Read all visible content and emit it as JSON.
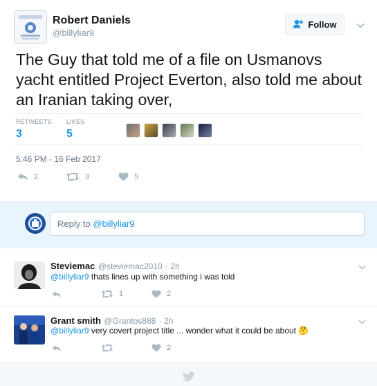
{
  "tweet": {
    "author_name": "Robert Daniels",
    "author_handle": "@billyliar9",
    "follow_label": "Follow",
    "text": "The Guy that told me of a file on Usmanovs yacht entitled Project Everton, also told me about an Iranian taking over,",
    "retweets_label": "RETWEETS",
    "retweets_count": "3",
    "likes_label": "LIKES",
    "likes_count": "5",
    "timestamp": "5:46 PM - 16 Feb 2017",
    "actions": {
      "reply_count": "2",
      "retweet_count": "3",
      "like_count": "5"
    }
  },
  "reply_box": {
    "prefix": "Reply to ",
    "mention": "@billyliar9"
  },
  "replies": [
    {
      "name": "Steviemac",
      "handle": "@steviemac2010",
      "time": "· 2h",
      "mention": "@billyliar9",
      "text": " thats lines up with something i was told",
      "retweet_count": "1",
      "like_count": "2"
    },
    {
      "name": "Grant smith",
      "handle": "@Grantos888",
      "time": "· 2h",
      "mention": "@billyliar9",
      "text": " very covert project title ...  wonder what it could be about 🤔",
      "retweet_count": "",
      "like_count": "2"
    }
  ],
  "colors": {
    "accent": "#1b95e0",
    "reply_bg": "#e8f5fd",
    "muted": "#8899a6"
  },
  "icons": [
    "follow-user-icon",
    "chevron-down-icon",
    "reply-icon",
    "retweet-icon",
    "heart-icon",
    "twitter-bird-icon"
  ]
}
